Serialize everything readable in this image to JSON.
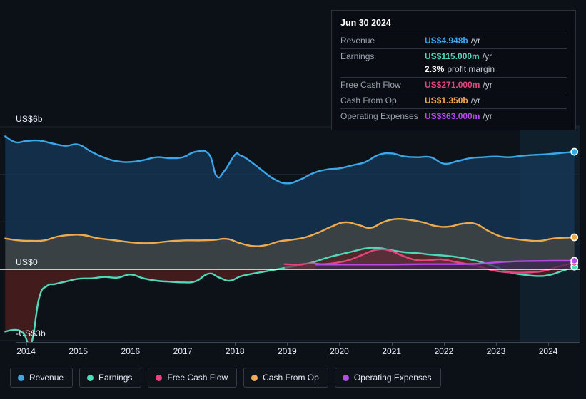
{
  "tooltip": {
    "date": "Jun 30 2024",
    "rows": [
      {
        "name": "Revenue",
        "value": "US$4.948b",
        "unit": "/yr",
        "color": "#3aa7e8"
      },
      {
        "name": "Earnings",
        "value": "US$115.000m",
        "unit": "/yr",
        "color": "#4fd9bb"
      },
      {
        "name": "",
        "value": "2.3%",
        "unit": "profit margin",
        "color": "#ffffff"
      },
      {
        "name": "Free Cash Flow",
        "value": "US$271.000m",
        "unit": "/yr",
        "color": "#e5447f"
      },
      {
        "name": "Cash From Op",
        "value": "US$1.350b",
        "unit": "/yr",
        "color": "#eeaa4d"
      },
      {
        "name": "Operating Expenses",
        "value": "US$363.000m",
        "unit": "/yr",
        "color": "#b44ae8"
      }
    ]
  },
  "legend": {
    "items": [
      {
        "label": "Revenue",
        "color": "#3aa7e8"
      },
      {
        "label": "Earnings",
        "color": "#4fd9bb"
      },
      {
        "label": "Free Cash Flow",
        "color": "#e5447f"
      },
      {
        "label": "Cash From Op",
        "color": "#eeaa4d"
      },
      {
        "label": "Operating Expenses",
        "color": "#b44ae8"
      }
    ]
  },
  "chart_data": {
    "type": "area",
    "title": "",
    "xlabel": "",
    "ylabel": "",
    "ylim": [
      -3,
      6
    ],
    "xlim": [
      2013.5,
      2024.6
    ],
    "grid": true,
    "legend_position": "bottom",
    "y_ticks": [
      {
        "value": 6,
        "label": "US$6b"
      },
      {
        "value": 4,
        "label": ""
      },
      {
        "value": 2,
        "label": ""
      },
      {
        "value": 0,
        "label": "US$0"
      },
      {
        "value": -3,
        "label": "-US$3b"
      }
    ],
    "x_ticks": [
      "2014",
      "2015",
      "2016",
      "2017",
      "2018",
      "2019",
      "2020",
      "2021",
      "2022",
      "2023",
      "2024"
    ],
    "zero_line": 0,
    "forecast_band_start": 2023.45,
    "units": "US$ billions per year",
    "series": [
      {
        "name": "Revenue",
        "color": "#3aa7e8",
        "fill": "#16395c",
        "end_marker": true,
        "end_value": 4.948,
        "x": [
          2013.6,
          2013.8,
          2014.0,
          2014.25,
          2014.5,
          2014.75,
          2015.0,
          2015.25,
          2015.5,
          2015.75,
          2016.0,
          2016.25,
          2016.5,
          2016.75,
          2017.0,
          2017.25,
          2017.5,
          2017.65,
          2017.8,
          2018.0,
          2018.1,
          2018.25,
          2018.5,
          2018.75,
          2019.0,
          2019.25,
          2019.5,
          2019.75,
          2020.0,
          2020.25,
          2020.5,
          2020.75,
          2021.0,
          2021.25,
          2021.5,
          2021.75,
          2022.0,
          2022.25,
          2022.5,
          2022.75,
          2023.0,
          2023.25,
          2023.5,
          2023.75,
          2024.0,
          2024.25,
          2024.5
        ],
        "y": [
          5.6,
          5.35,
          5.4,
          5.42,
          5.3,
          5.2,
          5.25,
          4.95,
          4.7,
          4.55,
          4.52,
          4.6,
          4.72,
          4.68,
          4.72,
          4.95,
          4.85,
          3.92,
          4.15,
          4.82,
          4.8,
          4.62,
          4.2,
          3.8,
          3.62,
          3.78,
          4.05,
          4.2,
          4.25,
          4.38,
          4.52,
          4.82,
          4.88,
          4.75,
          4.72,
          4.72,
          4.45,
          4.55,
          4.68,
          4.72,
          4.75,
          4.72,
          4.78,
          4.82,
          4.85,
          4.9,
          4.948
        ]
      },
      {
        "name": "Cash From Op",
        "color": "#eeaa4d",
        "fill": "#4a4a42",
        "end_marker": true,
        "end_value": 1.35,
        "x": [
          2013.6,
          2013.85,
          2014.1,
          2014.35,
          2014.6,
          2014.85,
          2015.1,
          2015.35,
          2015.6,
          2015.85,
          2016.1,
          2016.35,
          2016.6,
          2016.85,
          2017.1,
          2017.35,
          2017.6,
          2017.85,
          2018.1,
          2018.35,
          2018.6,
          2018.85,
          2019.1,
          2019.35,
          2019.6,
          2019.85,
          2020.1,
          2020.35,
          2020.6,
          2020.85,
          2021.1,
          2021.35,
          2021.6,
          2021.85,
          2022.1,
          2022.35,
          2022.6,
          2022.85,
          2023.1,
          2023.35,
          2023.6,
          2023.85,
          2024.1,
          2024.5
        ],
        "y": [
          1.3,
          1.22,
          1.2,
          1.22,
          1.38,
          1.45,
          1.44,
          1.32,
          1.25,
          1.18,
          1.12,
          1.1,
          1.15,
          1.2,
          1.22,
          1.22,
          1.24,
          1.28,
          1.1,
          0.98,
          1.02,
          1.18,
          1.25,
          1.35,
          1.55,
          1.8,
          1.98,
          1.88,
          1.75,
          2.0,
          2.12,
          2.08,
          1.98,
          1.82,
          1.8,
          1.92,
          1.92,
          1.62,
          1.38,
          1.28,
          1.22,
          1.2,
          1.3,
          1.35
        ]
      },
      {
        "name": "Earnings",
        "color": "#4fd9bb",
        "fill": "#58201f",
        "end_marker": true,
        "end_value": 0.115,
        "x": [
          2013.6,
          2013.8,
          2013.95,
          2014.1,
          2014.25,
          2014.4,
          2014.55,
          2014.75,
          2015.0,
          2015.25,
          2015.5,
          2015.75,
          2016.0,
          2016.25,
          2016.5,
          2016.75,
          2017.0,
          2017.25,
          2017.5,
          2017.7,
          2017.9,
          2018.1,
          2018.3,
          2018.5,
          2018.75,
          2019.0,
          2019.25,
          2019.5,
          2019.75,
          2020.0,
          2020.25,
          2020.5,
          2020.75,
          2021.0,
          2021.25,
          2021.5,
          2021.75,
          2022.0,
          2022.25,
          2022.5,
          2022.75,
          2023.0,
          2023.25,
          2023.5,
          2023.75,
          2024.0,
          2024.25,
          2024.5
        ],
        "y": [
          -2.62,
          -2.55,
          -2.7,
          -3.1,
          -1.2,
          -0.7,
          -0.62,
          -0.52,
          -0.4,
          -0.38,
          -0.32,
          -0.35,
          -0.22,
          -0.38,
          -0.48,
          -0.52,
          -0.55,
          -0.5,
          -0.18,
          -0.35,
          -0.48,
          -0.3,
          -0.2,
          -0.12,
          -0.02,
          0.08,
          0.18,
          0.3,
          0.48,
          0.62,
          0.75,
          0.88,
          0.9,
          0.8,
          0.72,
          0.68,
          0.62,
          0.58,
          0.52,
          0.42,
          0.28,
          0.1,
          -0.12,
          -0.22,
          -0.28,
          -0.25,
          -0.08,
          0.115
        ]
      },
      {
        "name": "Free Cash Flow",
        "color": "#e5447f",
        "fill": "#5b3140",
        "end_marker": true,
        "end_value": 0.271,
        "x": [
          2018.95,
          2019.2,
          2019.45,
          2019.7,
          2019.95,
          2020.2,
          2020.45,
          2020.7,
          2020.95,
          2021.2,
          2021.45,
          2021.7,
          2021.95,
          2022.2,
          2022.45,
          2022.7,
          2022.95,
          2023.2,
          2023.45,
          2023.7,
          2023.95,
          2024.2,
          2024.5
        ],
        "y": [
          0.22,
          0.2,
          0.25,
          0.22,
          0.28,
          0.4,
          0.62,
          0.82,
          0.8,
          0.58,
          0.4,
          0.38,
          0.42,
          0.32,
          0.22,
          0.1,
          -0.05,
          -0.12,
          -0.14,
          -0.12,
          -0.05,
          0.12,
          0.271
        ]
      },
      {
        "name": "Operating Expenses",
        "color": "#b44ae8",
        "fill": "#3b2550",
        "end_marker": true,
        "end_value": 0.363,
        "x": [
          2019.55,
          2019.9,
          2020.25,
          2020.6,
          2020.95,
          2021.3,
          2021.65,
          2022.0,
          2022.35,
          2022.7,
          2023.05,
          2023.4,
          2023.75,
          2024.1,
          2024.5
        ],
        "y": [
          0.2,
          0.2,
          0.2,
          0.2,
          0.2,
          0.21,
          0.22,
          0.22,
          0.22,
          0.24,
          0.3,
          0.34,
          0.35,
          0.36,
          0.363
        ]
      }
    ]
  },
  "colors": {
    "background": "#0c1118",
    "plot_background": "#0d1219",
    "zero_line": "#ffffff",
    "grid": "#1d2631",
    "axis_text": "#e8eef5",
    "forecast_band": "#14293c"
  }
}
